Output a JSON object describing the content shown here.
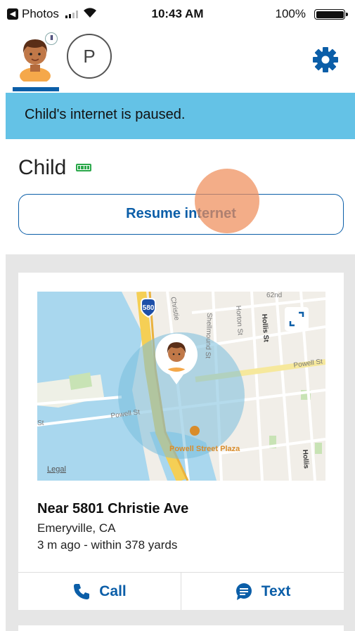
{
  "status_bar": {
    "back_app": "Photos",
    "time": "10:43 AM",
    "battery_percent": "100%"
  },
  "header": {
    "selected_child": "Child",
    "other_member_initial": "P",
    "pause_badge": "II",
    "icons": {
      "settings": "gear-icon"
    }
  },
  "banner": {
    "text": "Child's internet is paused."
  },
  "child": {
    "name": "Child",
    "device_battery": "battery-full-icon"
  },
  "resume_button": {
    "label": "Resume internet"
  },
  "location_card": {
    "map": {
      "highway_shield": "580",
      "street_labels": [
        "Christie",
        "Shellmound St",
        "Horton St",
        "Hollis St",
        "Powell St",
        "62nd",
        "Hollis",
        "St"
      ],
      "place_label": "Powell Street Plaza",
      "legal_label": "Legal"
    },
    "title": "Near 5801 Christie Ave",
    "city": "Emeryville, CA",
    "detail": "3 m ago - within 378 yards"
  },
  "actions": {
    "call_label": "Call",
    "text_label": "Text"
  },
  "colors": {
    "accent": "#0b5ea8",
    "banner": "#64c2e6",
    "battery_green": "#2aa84a",
    "touch_indicator": "#ee8e5a"
  }
}
